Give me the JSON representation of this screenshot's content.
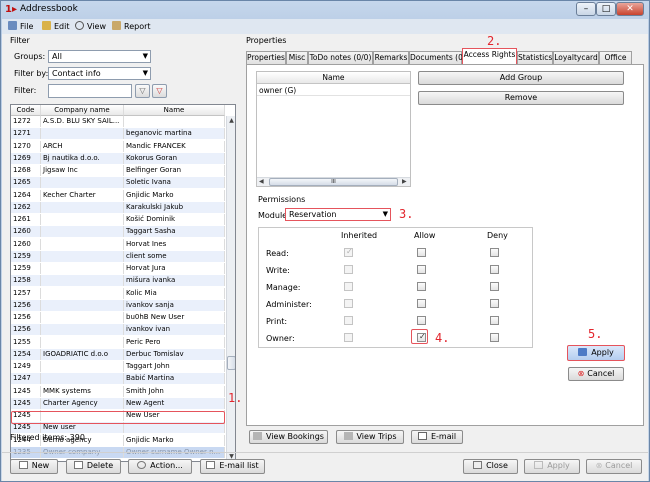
{
  "window": {
    "title": "Addressbook",
    "app_icon": "addressbook-icon",
    "controls": [
      "minimize",
      "maximize",
      "close"
    ]
  },
  "menu": [
    {
      "label": "File",
      "icon": "file-icon"
    },
    {
      "label": "Edit",
      "icon": "edit-icon"
    },
    {
      "label": "View",
      "icon": "view-icon"
    },
    {
      "label": "Report",
      "icon": "report-icon"
    }
  ],
  "filter": {
    "section_label": "Filter",
    "groups_label": "Groups:",
    "groups_value": "All",
    "filter_by_label": "Filter by:",
    "filter_by_value": "Contact info",
    "filter_label": "Filter:",
    "filter_value": ""
  },
  "grid": {
    "columns": [
      "Code",
      "Company name",
      "Name"
    ],
    "rows": [
      {
        "code": "1272",
        "company": "A.S.D. BLU SKY SAIL...",
        "name": ""
      },
      {
        "code": "1271",
        "company": "",
        "name": "beganovic martina"
      },
      {
        "code": "1270",
        "company": "ARCH",
        "name": "Mandic FRANCEK"
      },
      {
        "code": "1269",
        "company": "Bj nautika d.o.o.",
        "name": "Kokorus Goran"
      },
      {
        "code": "1268",
        "company": "Jigsaw Inc",
        "name": "Belfinger Goran"
      },
      {
        "code": "1265",
        "company": "",
        "name": "Soletic Ivana"
      },
      {
        "code": "1264",
        "company": "Kecher Charter",
        "name": "Gnjidic Marko"
      },
      {
        "code": "1262",
        "company": "",
        "name": "Karakulski Jakub"
      },
      {
        "code": "1261",
        "company": "",
        "name": "Košić Dominik"
      },
      {
        "code": "1260",
        "company": "",
        "name": "Taggart Sasha"
      },
      {
        "code": "1260",
        "company": "",
        "name": "Horvat Ines"
      },
      {
        "code": "1259",
        "company": "",
        "name": "client some"
      },
      {
        "code": "1259",
        "company": "",
        "name": "Horvat Jura"
      },
      {
        "code": "1258",
        "company": "",
        "name": "mišura ivanka"
      },
      {
        "code": "1257",
        "company": "",
        "name": "Kolic Mia"
      },
      {
        "code": "1256",
        "company": "",
        "name": "ivankov sanja"
      },
      {
        "code": "1256",
        "company": "",
        "name": "bu0hB New User"
      },
      {
        "code": "1256",
        "company": "",
        "name": "ivankov ivan"
      },
      {
        "code": "1255",
        "company": "",
        "name": "Peric Pero"
      },
      {
        "code": "1254",
        "company": "IGOADRIATIC d.o.o",
        "name": "Derbuc Tomislav"
      },
      {
        "code": "1249",
        "company": "",
        "name": "Taggart John"
      },
      {
        "code": "1247",
        "company": "",
        "name": "Babić Martina"
      },
      {
        "code": "1245",
        "company": "MMK systems",
        "name": "Smith John"
      },
      {
        "code": "1245",
        "company": "Charter Agency",
        "name": "New Agent"
      },
      {
        "code": "1245",
        "company": "",
        "name": "New User"
      },
      {
        "code": "1245",
        "company": "New user",
        "name": ""
      },
      {
        "code": "1244",
        "company": "Demo agency",
        "name": "Gnjidic Marko"
      },
      {
        "code": "1235",
        "company": "Owner company",
        "name": "Owner surname Owner n..."
      }
    ],
    "selected_index": 27
  },
  "filtered_items": "Filtered items:  390",
  "properties": {
    "section_label": "Properties",
    "tabs": [
      "Properties",
      "Misc",
      "ToDo notes (0/0)",
      "Remarks",
      "Documents (0)",
      "Access Rights",
      "Statistics",
      "Loyaltycard",
      "Office"
    ],
    "active_tab": "Access Rights",
    "name_column": "Name",
    "names": [
      "owner (G)"
    ],
    "add_group_label": "Add Group",
    "remove_label": "Remove",
    "scroll_label": "III",
    "permissions": {
      "section_label": "Permissions",
      "module_label": "Module",
      "module_value": "Reservation",
      "headers": [
        "Inherited",
        "Allow",
        "Deny"
      ],
      "rows": [
        {
          "label": "Read:",
          "inherited": true,
          "allow": false,
          "deny": false
        },
        {
          "label": "Write:",
          "inherited": false,
          "allow": false,
          "deny": false
        },
        {
          "label": "Manage:",
          "inherited": false,
          "allow": false,
          "deny": false
        },
        {
          "label": "Administer:",
          "inherited": false,
          "allow": false,
          "deny": false
        },
        {
          "label": "Print:",
          "inherited": false,
          "allow": false,
          "deny": false
        },
        {
          "label": "Owner:",
          "inherited": false,
          "allow": true,
          "deny": false
        }
      ]
    },
    "apply_label": "Apply",
    "cancel_label": "Cancel"
  },
  "bottom_buttons": {
    "view_bookings": "View Bookings",
    "view_trips": "View Trips",
    "email": "E-mail"
  },
  "footer": {
    "new": "New",
    "delete": "Delete",
    "action": "Action...",
    "email_list": "E-mail list",
    "close": "Close",
    "apply": "Apply",
    "cancel": "Cancel"
  },
  "annotations": [
    "1.",
    "2.",
    "3.",
    "4.",
    "5."
  ],
  "colors": {
    "highlight": "#e5545c",
    "annotation": "#e3262e",
    "selection": "#c9d9f2",
    "alt_row": "#eaf0fb"
  }
}
